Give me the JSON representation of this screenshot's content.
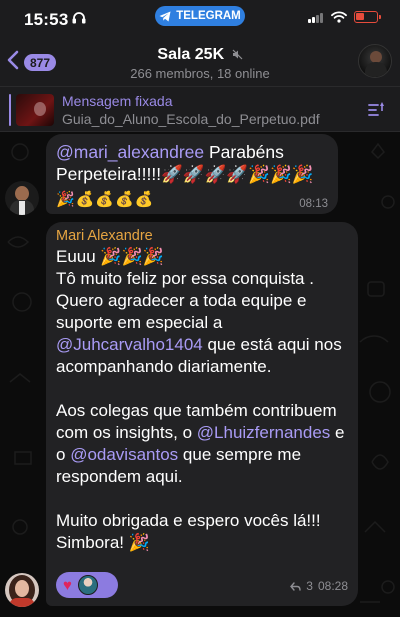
{
  "status_bar": {
    "time": "15:53",
    "app_pill_label": "TELEGRAM",
    "battery_color": "#e74c3c"
  },
  "header": {
    "back_count": "877",
    "title": "Sala 25K",
    "subtitle": "266 membros, 18 online",
    "accent_color": "#9a8ae6"
  },
  "pinned": {
    "title": "Mensagem fixada",
    "file_name": "Guia_do_Aluno_Escola_do_Perpetuo.pdf"
  },
  "messages": [
    {
      "mention": "@mari_alexandree",
      "text_after_mention": " Parabéns Perpeteira!!!!!",
      "line1_emojis": "🚀🚀🚀🚀🎉🎉🎉",
      "line2_emojis": "🎉💰💰💰💰",
      "time": "08:13"
    },
    {
      "sender": "Mari Alexandre",
      "sender_color": "#e6a542",
      "line_1": "Euuu 🎉🎉🎉",
      "line_2": "Tô muito feliz por essa conquista . Quero agradecer a toda equipe e suporte em especial a ",
      "mention_1": "@Juhcarvalho1404",
      "line_2b": " que está aqui nos acompanhando diariamente.",
      "line_3": "Aos colegas que também contribuem com os insights, o ",
      "mention_2": "@Lhuizfernandes",
      "line_3b": " e o ",
      "mention_3": "@odavisantos",
      "line_3c": " que sempre me respondem aqui.",
      "line_4": "Muito obrigada e espero vocês lá!!! Simbora! 🎉",
      "reaction_emoji": "♥",
      "reply_count": "3",
      "time": "08:28"
    }
  ]
}
